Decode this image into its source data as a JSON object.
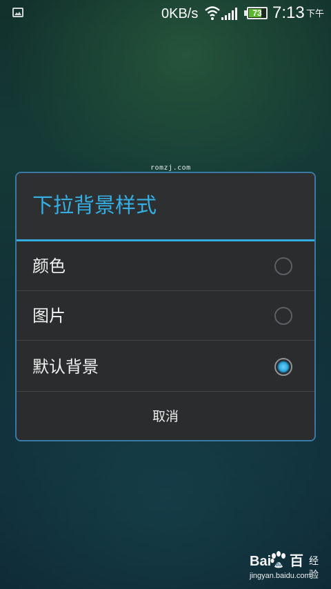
{
  "status_bar": {
    "network_speed": "0KB/s",
    "battery_level": 73,
    "battery_text": "73",
    "time": "7:13",
    "ampm": "下午",
    "icons": [
      "image-icon",
      "wifi-icon",
      "signal-icon",
      "battery-icon"
    ]
  },
  "watermark_top": "romzj.com",
  "dialog": {
    "title": "下拉背景样式",
    "options": [
      {
        "label": "颜色",
        "selected": false
      },
      {
        "label": "图片",
        "selected": false
      },
      {
        "label": "默认背景",
        "selected": true
      }
    ],
    "cancel_label": "取消"
  },
  "baidu_watermark": {
    "logo_left": "Bai",
    "logo_right": "百",
    "jingyan": "经验",
    "url": "jingyan.baidu.com"
  },
  "colors": {
    "accent": "#34aee3",
    "dialog_border": "#3a7aa6",
    "dialog_bg": "#2b2c2d",
    "battery_fill": "#5bb82e"
  }
}
